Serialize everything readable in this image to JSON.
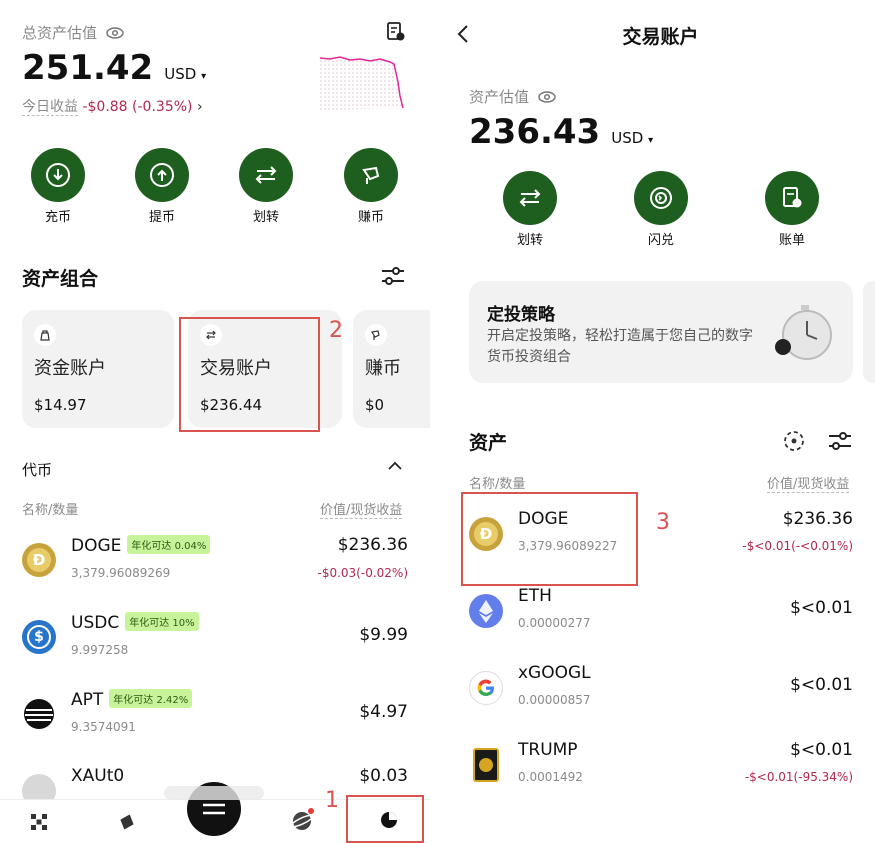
{
  "left": {
    "total_label": "总资产估值",
    "total_value": "251.42",
    "currency": "USD",
    "today_label": "今日收益",
    "today_value": "-$0.88 (-0.35%)",
    "actions": [
      {
        "label": "充币",
        "icon": "download-icon"
      },
      {
        "label": "提币",
        "icon": "upload-icon"
      },
      {
        "label": "划转",
        "icon": "transfer-icon"
      },
      {
        "label": "赚币",
        "icon": "earn-icon"
      }
    ],
    "portfolio_title": "资产组合",
    "accounts": [
      {
        "name": "资金账户",
        "value": "$14.97",
        "icon": "bag-icon"
      },
      {
        "name": "交易账户",
        "value": "$236.44",
        "icon": "swap-icon"
      },
      {
        "name": "赚币",
        "value": "$0",
        "icon": "earn-icon"
      }
    ],
    "tokens_section": "代币",
    "col_left": "名称/数量",
    "col_right": "价值/现货收益",
    "tokens": [
      {
        "name": "DOGE",
        "tag": "年化可达 0.04%",
        "qty": "3,379.96089269",
        "value": "$236.36",
        "pnl": "-$0.03(-0.02%)"
      },
      {
        "name": "USDC",
        "tag": "年化可达 10%",
        "qty": "9.997258",
        "value": "$9.99",
        "pnl": ""
      },
      {
        "name": "APT",
        "tag": "年化可达 2.42%",
        "qty": "9.3574091",
        "value": "$4.97",
        "pnl": ""
      },
      {
        "name": "XAUt0",
        "tag": "",
        "qty": "",
        "value": "$0.03",
        "pnl": ""
      }
    ],
    "annotations": [
      "2",
      "1"
    ]
  },
  "right": {
    "title": "交易账户",
    "est_label": "资产估值",
    "est_value": "236.43",
    "currency": "USD",
    "actions": [
      {
        "label": "划转",
        "icon": "transfer-icon"
      },
      {
        "label": "闪兑",
        "icon": "flash-swap-icon"
      },
      {
        "label": "账单",
        "icon": "bill-icon"
      }
    ],
    "promo_title": "定投策略",
    "promo_text": "开启定投策略，轻松打造属于您自己的数字货币投资组合",
    "assets_title": "资产",
    "col_left": "名称/数量",
    "col_right": "价值/现货收益",
    "tokens": [
      {
        "name": "DOGE",
        "qty": "3,379.96089227",
        "value": "$236.36",
        "pnl": "-$<0.01(-<0.01%)"
      },
      {
        "name": "ETH",
        "qty": "0.00000277",
        "value": "$<0.01",
        "pnl": ""
      },
      {
        "name": "xGOOGL",
        "qty": "0.00000857",
        "value": "$<0.01",
        "pnl": ""
      },
      {
        "name": "TRUMP",
        "qty": "0.0001492",
        "value": "$<0.01",
        "pnl": "-$<0.01(-95.34%)"
      }
    ],
    "annotations": [
      "3"
    ]
  },
  "colors": {
    "accent_green": "#1e5e1f",
    "loss_red": "#b0284f",
    "tag_green": "#c9f39b",
    "annotation_red": "#d9534f"
  }
}
